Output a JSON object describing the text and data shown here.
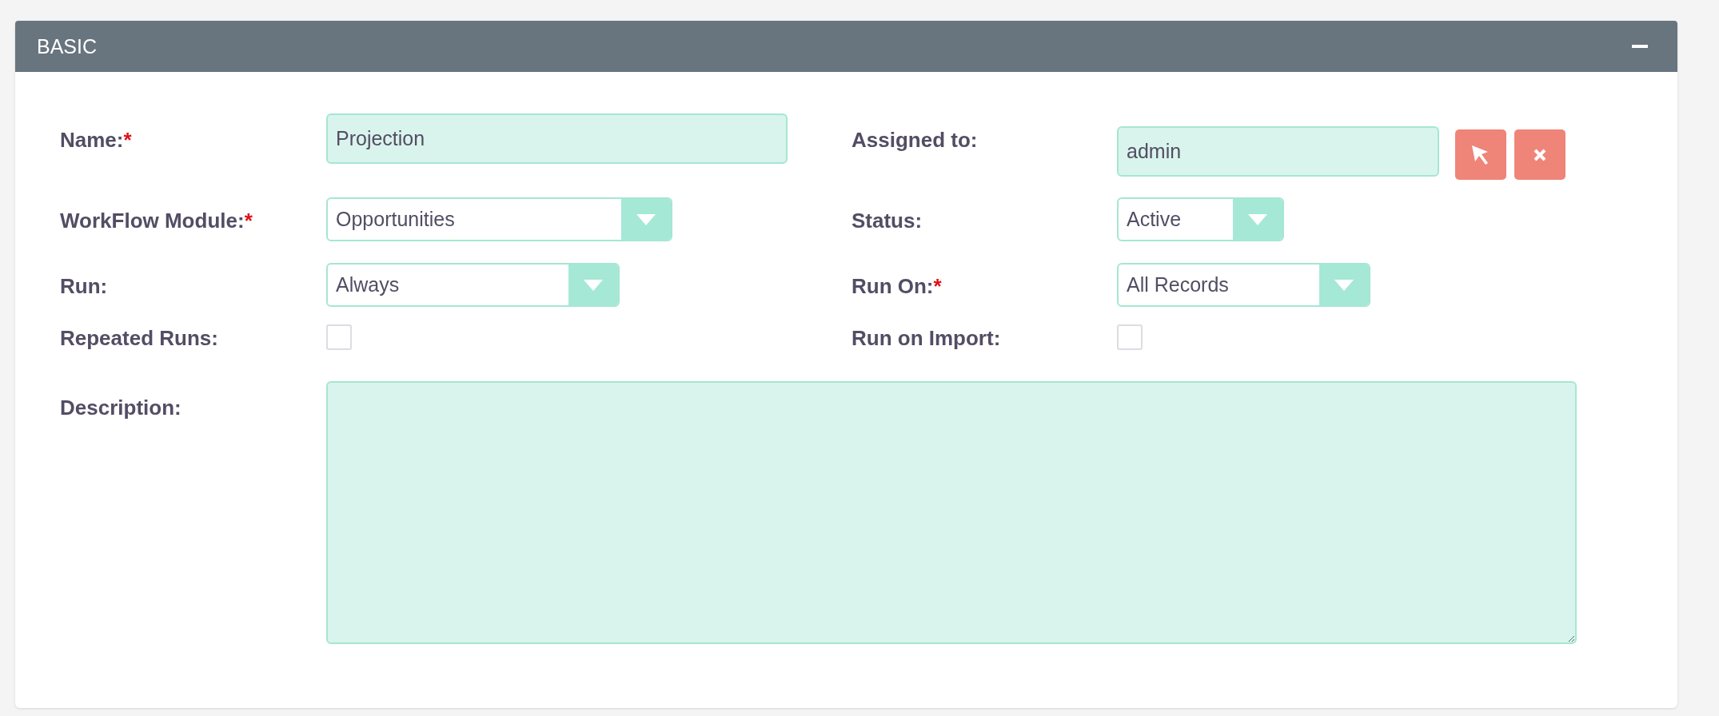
{
  "panel": {
    "title": "BASIC",
    "expanded": true
  },
  "rows": [
    {
      "left": {
        "kind": "text",
        "label": "Name:",
        "required_mark": "*",
        "value": "Projection"
      },
      "right": {
        "kind": "relate",
        "label": "Assigned to:",
        "value": "admin"
      }
    },
    {
      "left": {
        "kind": "select",
        "label": "WorkFlow Module:",
        "required_mark": "*",
        "value": "Opportunities"
      },
      "right": {
        "kind": "select",
        "label": "Status:",
        "value": "Active"
      }
    },
    {
      "left": {
        "kind": "select",
        "label": "Run:",
        "value": "Always"
      },
      "right": {
        "kind": "select",
        "label": "Run On:",
        "required_mark": "*",
        "value": "All Records"
      }
    },
    {
      "left": {
        "kind": "checkbox",
        "label": "Repeated Runs:",
        "checked": false
      },
      "right": {
        "kind": "checkbox",
        "label": "Run on Import:",
        "checked": false
      }
    },
    {
      "left": {
        "kind": "textarea",
        "label": "Description:"
      }
    }
  ]
}
